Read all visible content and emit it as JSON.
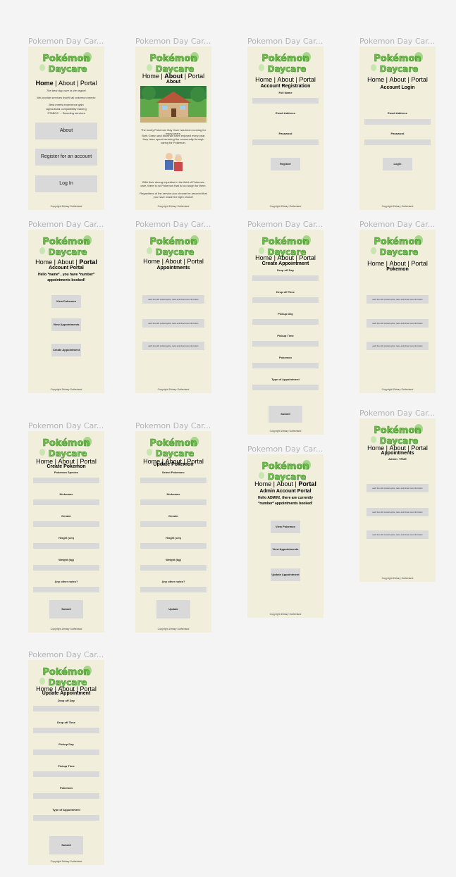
{
  "frame_label": "Pokemon Day Car...",
  "logo_text": "Pokémon Daycare",
  "nav": {
    "home": "Home",
    "about": "About",
    "portal": "Portal",
    "sep": "|"
  },
  "copyright": "Copyright Zebary Sutherland",
  "home": {
    "title": "Home",
    "tagline": "The best day care in the region!",
    "intro": "We provide services that fit all pokemon needs:",
    "bullets": [
      "Best meets experience gain",
      "Agricultural compatibility training",
      "STABOC ... Breeding services"
    ],
    "about_btn": "About",
    "register_btn": "Register for an account",
    "login_btn": "Log In"
  },
  "about": {
    "title": "About",
    "p1": "The lovely Pokemon Day Care has been running for many years.",
    "p2": "Both Grann and Maxthan have enjoyed every year they have spent servicing the community through caring for Pokemon.",
    "p3": "With their strong expertise in the field of Pokemon care, there is no Pokemon that is too tough for them.",
    "p4": "Regardless of the service you choose be assured that you have made the right choice!"
  },
  "register": {
    "title": "Account Registration",
    "full_name": "Full Name",
    "email": "Email Address",
    "password": "Password",
    "button": "Register"
  },
  "login": {
    "title": "Account Login",
    "email": "Email Address",
    "password": "Password",
    "button": "Login"
  },
  "portal": {
    "title": "Account Portal",
    "hello": "Hello *name* , you have *number* appointments booked!",
    "view_pokemon": "View Pokemon",
    "view_appts": "View Appointments",
    "create_appt": "Create Appointment"
  },
  "appointments": {
    "title": "Appointments",
    "row": "each box with contain sprite, name and show more info button"
  },
  "create_appt": {
    "title": "Create Appointment",
    "fields": [
      "Drop off Day",
      "Drop off Time",
      "Pickup Day",
      "Pickup Time",
      "Pokemon",
      "Type of Appointment"
    ],
    "button": "Submit"
  },
  "pokemon": {
    "title": "Pokemon",
    "row": "each box with contain sprite, name and show more info button"
  },
  "create_pokemon": {
    "title": "Create Pokemon",
    "fields": [
      "Pokemon Species",
      "Nickname",
      "Gender",
      "Height (cm)",
      "Weight (kg)",
      "Any other notes?"
    ],
    "button": "Submit"
  },
  "update_pokemon": {
    "title": "Update Pokemon",
    "fields": [
      "Select Pokemon:",
      "Nickname",
      "Gender",
      "Height (cm)",
      "Weight (kg)",
      "Any other notes?"
    ],
    "button": "Update"
  },
  "admin_portal": {
    "title": "Admin Account Portal",
    "hello": "Hello ADMIN!, there are currently *number* appointments booked!",
    "view_pokemon": "View Pokemon",
    "view_appts": "View Appointments",
    "update_appt": "Update Appointment"
  },
  "admin_appts": {
    "title": "Appointments",
    "subtitle": "Admin: TRUE",
    "row": "each box with contain sprite, name and show more info button"
  },
  "update_appt": {
    "title": "Update Appointment",
    "fields": [
      "Drop off Day",
      "Drop off Time",
      "Pickup Day",
      "Pickup Time",
      "Pokemon",
      "Type of Appointment"
    ],
    "button": "Submit"
  }
}
